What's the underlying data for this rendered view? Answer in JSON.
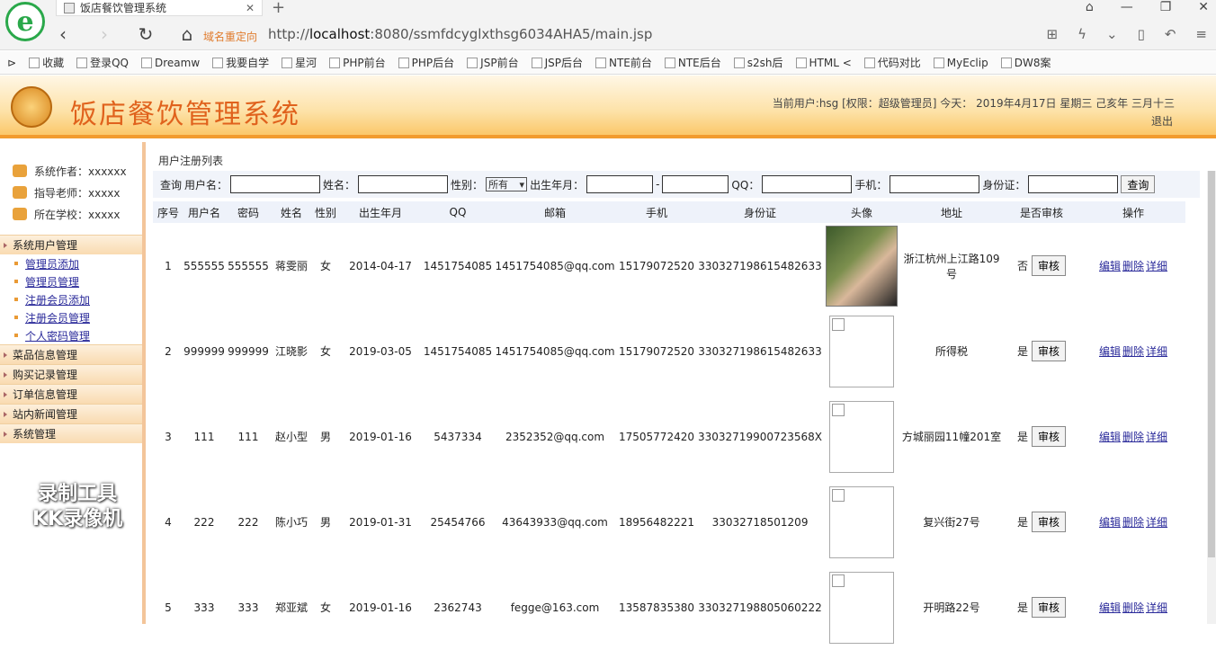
{
  "browser": {
    "tab_title": "饭店餐饮管理系统",
    "redirect_label": "域名重定向",
    "url_prefix": "http://",
    "url_host": "localhost",
    "url_rest": ":8080/ssmfdcyglxthsg6034AHA5/main.jsp",
    "bookmarks": [
      "收藏",
      "登录QQ",
      "Dreamw",
      "我要自学",
      "星河",
      "PHP前台",
      "PHP后台",
      "JSP前台",
      "JSP后台",
      "NTE前台",
      "NTE后台",
      "s2sh后",
      "HTML <",
      "代码对比",
      "MyEclip",
      "DW8案"
    ]
  },
  "header": {
    "system_name": "饭店餐饮管理系统",
    "user_info": "当前用户:hsg [权限：超级管理员] 今天： 2019年4月17日 星期三 己亥年 三月十三",
    "logout": "退出"
  },
  "sidebar": {
    "info": [
      "系统作者：xxxxxx",
      "指导老师：xxxxx",
      "所在学校：xxxxx"
    ],
    "groups": [
      {
        "label": "系统用户管理",
        "items": [
          "管理员添加",
          "管理员管理",
          "注册会员添加",
          "注册会员管理",
          "个人密码管理"
        ]
      },
      {
        "label": "菜品信息管理"
      },
      {
        "label": "购买记录管理"
      },
      {
        "label": "订单信息管理"
      },
      {
        "label": "站内新闻管理"
      },
      {
        "label": "系统管理"
      }
    ],
    "watermark": [
      "录制工具",
      "KK录像机"
    ]
  },
  "main": {
    "crumb": "用户注册列表",
    "search": {
      "prefix": "查询",
      "username": "用户名：",
      "name": "姓名：",
      "gender": "性别：",
      "gender_value": "所有",
      "birth": "出生年月：",
      "dash": "-",
      "qq": "QQ：",
      "phone": "手机：",
      "idcard": "身份证：",
      "button": "查询"
    },
    "columns": [
      "序号",
      "用户名",
      "密码",
      "姓名",
      "性别",
      "出生年月",
      "QQ",
      "邮箱",
      "手机",
      "身份证",
      "头像",
      "地址",
      "是否审核",
      "操作"
    ],
    "audit_button": "审核",
    "ops": [
      "编辑",
      "删除",
      "详细"
    ],
    "rows": [
      [
        "1",
        "555555",
        "555555",
        "蒋雯丽",
        "女",
        "2014-04-17",
        "1451754085",
        "1451754085@qq.com",
        "15179072520",
        "330327198615482633",
        "",
        "浙江杭州上江路109号",
        "否"
      ],
      [
        "2",
        "999999",
        "999999",
        "江晓影",
        "女",
        "2019-03-05",
        "1451754085",
        "1451754085@qq.com",
        "15179072520",
        "330327198615482633",
        "",
        "所得税",
        "是"
      ],
      [
        "3",
        "111",
        "111",
        "赵小型",
        "男",
        "2019-01-16",
        "5437334",
        "2352352@qq.com",
        "17505772420",
        "33032719900723568X",
        "",
        "方城丽园11幢201室",
        "是"
      ],
      [
        "4",
        "222",
        "222",
        "陈小巧",
        "男",
        "2019-01-31",
        "25454766",
        "43643933@qq.com",
        "18956482221",
        "33032718501209",
        "",
        "复兴街27号",
        "是"
      ],
      [
        "5",
        "333",
        "333",
        "郑亚斌",
        "女",
        "2019-01-16",
        "2362743",
        "fegge@163.com",
        "13587835380",
        "330327198805060222",
        "",
        "开明路22号",
        "是"
      ]
    ]
  }
}
